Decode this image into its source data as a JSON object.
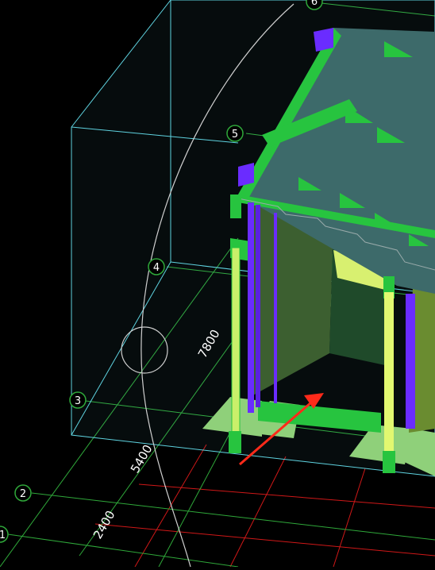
{
  "viewport": {
    "background": "#000000",
    "colors": {
      "bounding_box": "#5fd3e0",
      "grid_green": "#2fa83a",
      "grid_red": "#d01818",
      "arc": "#cfcfcf",
      "roof": "#3d6a6a",
      "frame_green": "#27c43f",
      "purple": "#6a2cff",
      "light_green": "#8fd07a",
      "yellow_green": "#c9f06a",
      "wall": "#3c5f30",
      "arrow": "#ff2a1a"
    }
  },
  "axis_markers": [
    {
      "label": "6"
    },
    {
      "label": "5"
    },
    {
      "label": "4"
    },
    {
      "label": "3"
    },
    {
      "label": "2"
    },
    {
      "label": "1"
    }
  ],
  "dimensions": [
    {
      "label": "7800"
    },
    {
      "label": "5400"
    },
    {
      "label": "2400"
    }
  ]
}
